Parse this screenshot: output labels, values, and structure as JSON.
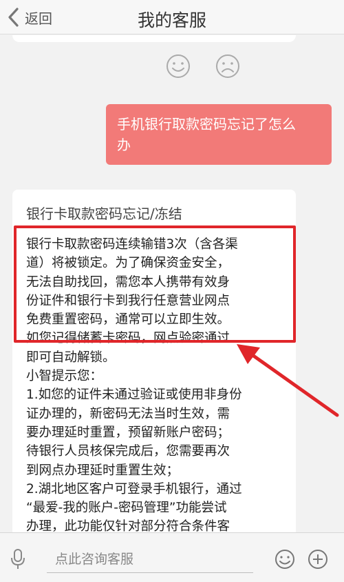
{
  "header": {
    "back_label": "返回",
    "title": "我的客服"
  },
  "feedback": {
    "like_icon": "smile-face",
    "dislike_icon": "sad-face"
  },
  "messages": {
    "user_question": "手机银行取款密码忘记了怎么\n办",
    "bot_title": "银行卡取款密码忘记/冻结",
    "bot_body": "银行卡取款密码连续输错3次（含各渠\n道）将被锁定。为了确保资金安全，\n无法自助找回，需您本人携带有效身\n份证件和银行卡到我行任意营业网点\n免费重置密码，通常可以立即生效。\n如您记得储蓄卡密码，网点验密通过\n即可自动解锁。\n小智提示您：\n1.如您的证件未通过验证或使用非身份\n证办理的，新密码无法当时生效，需\n要办理延时重置，预留新账户密码；\n待银行人员核保完成后，您需要再次\n到网点办理延时重置生效；\n2.湖北地区客户可登录手机银行，通过\n“最爱-我的账户-密码管理”功能尝试\n办理，此功能仅针对部分符合条件客\n户开放，具体请以页面显示为准；"
  },
  "annotation": {
    "frame_color": "#e0262a",
    "arrow_color": "#e0262a"
  },
  "input_bar": {
    "placeholder": "点此咨询客服"
  },
  "colors": {
    "user_bubble": "#f27a78",
    "background": "#f2f2f2"
  }
}
